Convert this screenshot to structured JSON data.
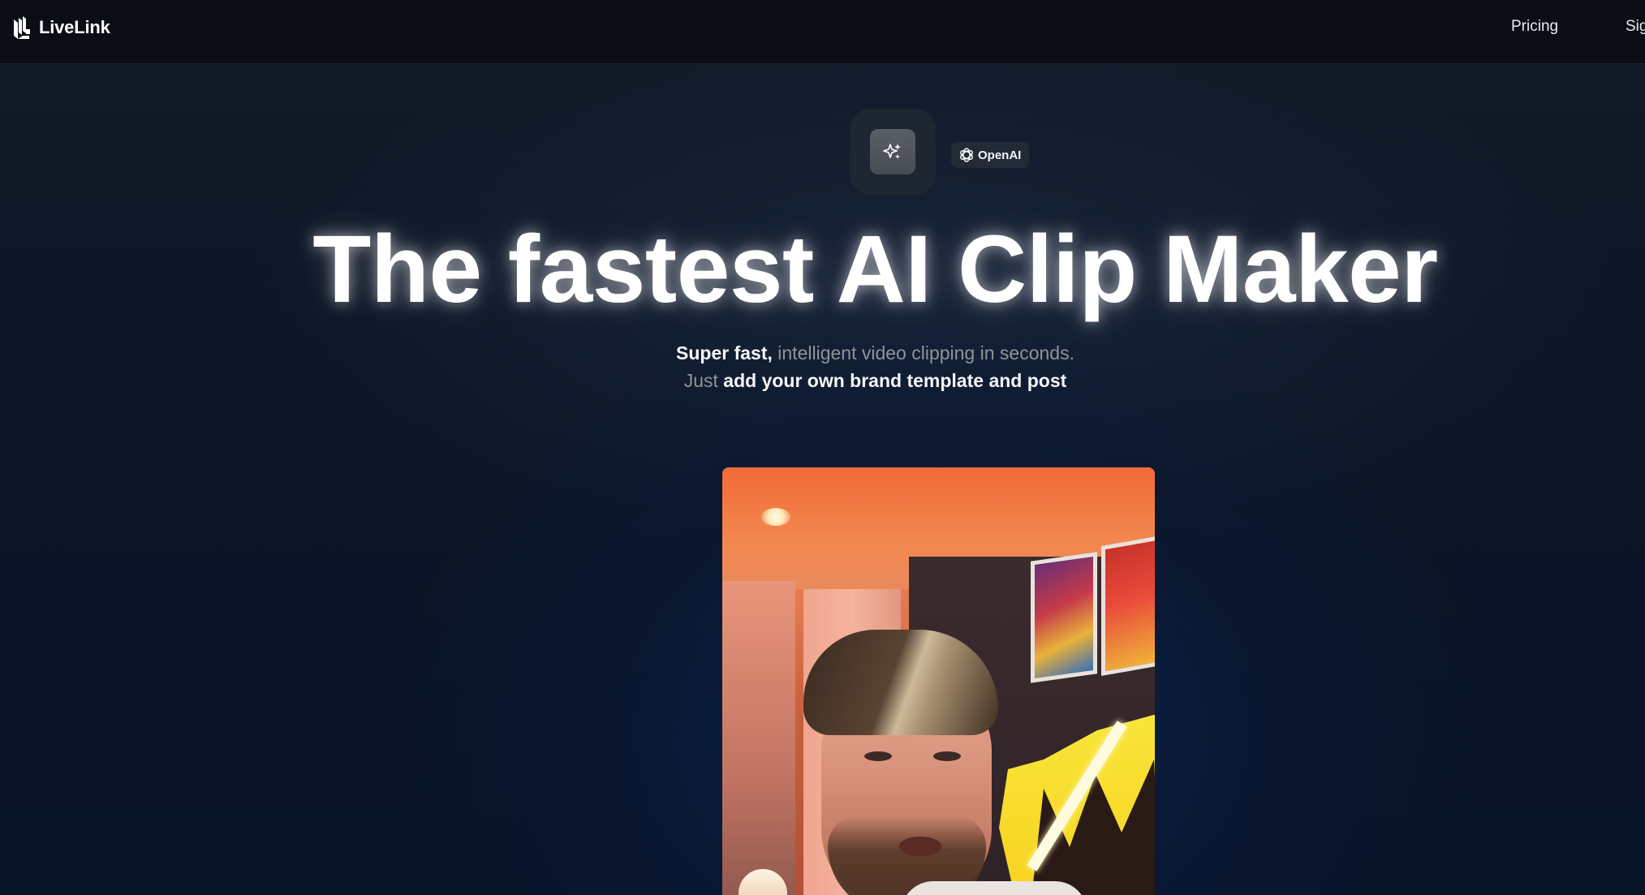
{
  "header": {
    "brand": "LiveLink",
    "nav": {
      "pricing": "Pricing",
      "signin": "Sig"
    }
  },
  "badges": {
    "sparkle_icon": "sparkle-icon",
    "openai_label": "OpenAI",
    "openai_icon": "openai-icon"
  },
  "hero": {
    "headline": "The fastest AI Clip Maker",
    "subtitle_line1_a": "Super fast, ",
    "subtitle_line1_b": "intelligent video clipping in seconds.",
    "subtitle_line2_a": "Just ",
    "subtitle_line2_b": "add your own brand template and post"
  },
  "colors": {
    "background": "#0b1220",
    "header_bg": "#0a0d14",
    "text_primary": "#ffffff",
    "text_muted": "#8e949d"
  }
}
